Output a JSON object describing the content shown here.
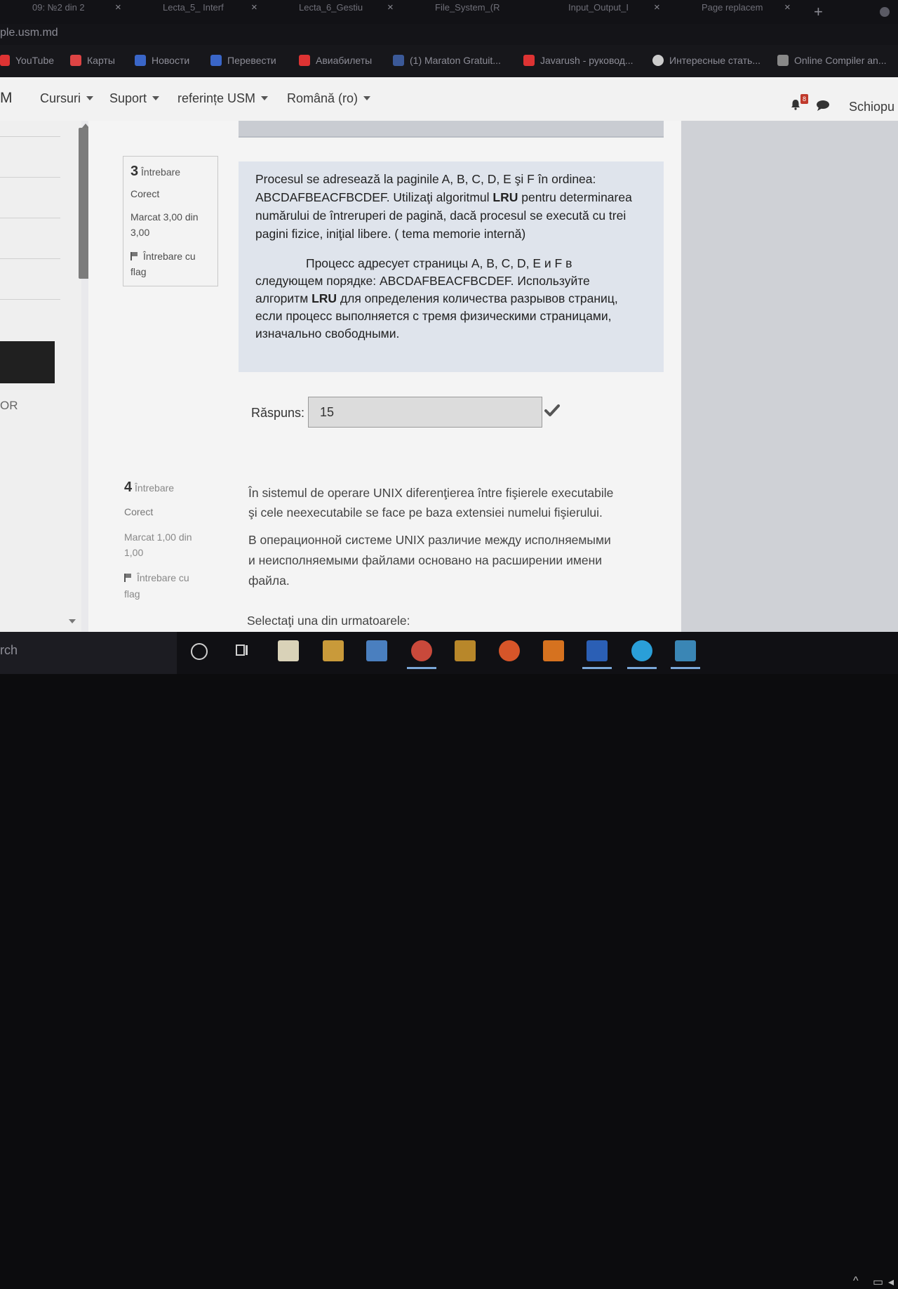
{
  "browser": {
    "tabs": [
      {
        "title": "09: №2 din 2"
      },
      {
        "title": "Lecta_5_ Interf"
      },
      {
        "title": "Lecta_6_Gestiu"
      },
      {
        "title": "File_System_(R"
      },
      {
        "title": "Input_Output_I"
      },
      {
        "title": "Page replacem"
      }
    ],
    "url": "ple.usm.md",
    "bookmarks": [
      {
        "label": "YouTube",
        "icon": "youtube-icon",
        "color": "#d33"
      },
      {
        "label": "Карты",
        "icon": "maps-icon",
        "color": "#d44"
      },
      {
        "label": "Новости",
        "icon": "news-icon",
        "color": "#3a66c8"
      },
      {
        "label": "Перевести",
        "icon": "translate-icon",
        "color": "#3a66c8"
      },
      {
        "label": "Авиабилеты",
        "icon": "plane-icon",
        "color": "#d33"
      },
      {
        "label": "(1) Maraton Gratuit...",
        "icon": "facebook-icon",
        "color": "#3b5998"
      },
      {
        "label": "Javarush - руковод...",
        "icon": "javarush-icon",
        "color": "#d33"
      },
      {
        "label": "Интересные стать...",
        "icon": "globe-icon",
        "color": "#ccc"
      },
      {
        "label": "Online Compiler an...",
        "icon": "ide-icon",
        "color": "#888"
      }
    ]
  },
  "navbar": {
    "brand": "M",
    "items": [
      {
        "label": "Cursuri"
      },
      {
        "label": "Suport"
      },
      {
        "label": "referințe USM"
      },
      {
        "label": "Română (ro)"
      }
    ],
    "notification_count": "8",
    "user": "Schiopu"
  },
  "sidebar": {
    "partial_label": "OR"
  },
  "question3": {
    "number": "3",
    "label": "Întrebare",
    "status": "Corect",
    "mark_line1": "Marcat 3,00 din",
    "mark_line2": "3,00",
    "flag_line1": "Întrebare cu",
    "flag_line2": "flag",
    "text_ro": [
      "Procesul se adresează la paginile A, B, C, D, E şi F în ordinea:",
      "ABCDAFBEACFBCDEF. Utilizaţi algoritmul LRU pentru determinarea",
      "numărului de întreruperi de pagină, dacă procesul se execută cu trei",
      "pagini fizice, iniţial libere.        ( tema memorie internă)"
    ],
    "text_ru": [
      "Процесс адресует страницы A, B, C, D, E и F в",
      "следующем порядке: ABCDAFBEACFBCDEF. Используйте",
      "алгоритм LRU для определения количества разрывов страниц,",
      "если процесс выполняется с тремя физическими страницами,",
      "изначально свободными."
    ],
    "answer_label": "Răspuns:",
    "answer_value": "15",
    "answer_correct": true
  },
  "question4": {
    "number": "4",
    "label": "Întrebare",
    "status": "Corect",
    "mark_line1": "Marcat 1,00 din",
    "mark_line2": "1,00",
    "flag_line1": "Întrebare cu",
    "flag_line2": "flag",
    "text_ro": [
      "În sistemul de operare UNIX diferenţierea între fişierele executabile",
      "şi cele neexecutabile se face pe baza extensiei numelui fişierului."
    ],
    "text_ru": [
      "В операционной системе UNIX различие между исполняемыми",
      "и неисполняемыми файлами основано на расширении имени",
      "файла."
    ],
    "prompt": "Selectaţi una din urmatoarele:"
  },
  "taskbar": {
    "search_text": "rch",
    "apps": [
      {
        "icon": "notepad-icon",
        "color": "#e8e1c8"
      },
      {
        "icon": "file-explorer-icon",
        "color": "#d8a640"
      },
      {
        "icon": "store-icon",
        "color": "#4f86c6"
      },
      {
        "icon": "chrome-icon",
        "color": "#d94b3c"
      },
      {
        "icon": "winrar-icon",
        "color": "#c9952a"
      },
      {
        "icon": "ubuntu-icon",
        "color": "#e05a2b"
      },
      {
        "icon": "sublime-icon",
        "color": "#e07a22"
      },
      {
        "icon": "word-icon",
        "color": "#2b5fb5"
      },
      {
        "icon": "skype-icon",
        "color": "#2aa3e0"
      },
      {
        "icon": "photos-icon",
        "color": "#3e8fbf"
      }
    ]
  },
  "colors": {
    "navbar_bg": "#f2f2f2",
    "question_text_bg": "#dfe4ec",
    "badge": "#c0392b"
  }
}
